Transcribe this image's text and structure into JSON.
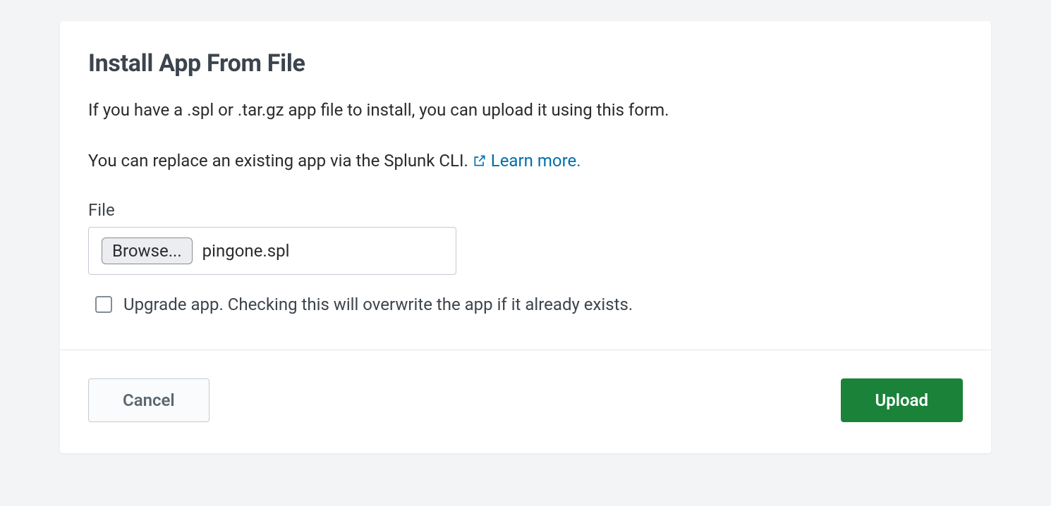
{
  "header": {
    "title": "Install App From File"
  },
  "body": {
    "description1": "If you have a .spl or .tar.gz app file to install, you can upload it using this form.",
    "description2_prefix": "You can replace an existing app via the Splunk CLI. ",
    "learn_more_label": "Learn more.",
    "file_label": "File",
    "browse_label": "Browse...",
    "selected_file": "pingone.spl",
    "upgrade_checkbox_label": "Upgrade app. Checking this will overwrite the app if it already exists.",
    "upgrade_checked": false
  },
  "footer": {
    "cancel_label": "Cancel",
    "upload_label": "Upload"
  },
  "colors": {
    "accent_green": "#1a8239",
    "link_blue": "#006eaa"
  }
}
